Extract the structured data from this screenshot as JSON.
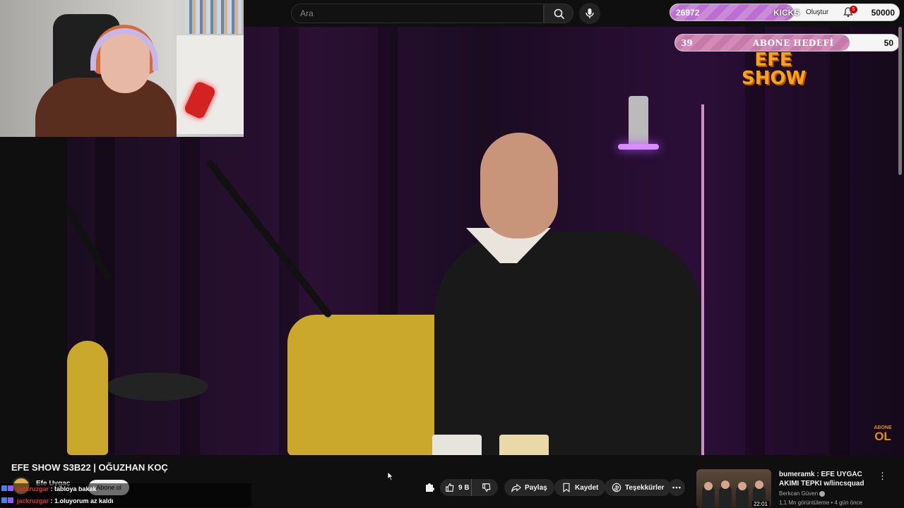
{
  "search": {
    "placeholder": "Ara"
  },
  "topbar": {
    "create_label": "Oluştur",
    "notification_count": "5"
  },
  "kicks": {
    "current": "26972",
    "label": "KICKS",
    "target": "50000",
    "progress": 0.54
  },
  "subscriber_goal": {
    "current": "39",
    "label": "ABONE HEDEFİ",
    "target": "50",
    "progress": 0.78
  },
  "overlay": {
    "logo_line1": "EFE",
    "logo_line2": "SHOW",
    "corner_small": "ABONE",
    "corner_big": "OL"
  },
  "video": {
    "title": "EFE SHOW S3B22 | OĞUZHAN KOÇ",
    "channel": "Efe Uygaç",
    "subscribe_label": "Abone ol"
  },
  "actions": {
    "like_count": "9 B",
    "share_label": "Paylaş",
    "save_label": "Kaydet",
    "thanks_label": "Teşekkürler"
  },
  "chat": [
    {
      "user": "jackruzgar",
      "message": " : tabloya bakak"
    },
    {
      "user": "jackruzgar",
      "message": " : 1.oluyorum az kaldı"
    }
  ],
  "recommendation": {
    "title": "bumeramk : EFE UYGAC AKIMI TEPKI w/lincsquad",
    "channel": "Berkcan Güven",
    "meta": "1,1 Mn görüntüleme • 4 gün önce",
    "duration": "22:01"
  },
  "colors": {
    "kicks_fill": "#bb6fd0",
    "goal_fill": "#c77aa9",
    "logo": "#f5a516",
    "chat_user": "#e0303a"
  }
}
